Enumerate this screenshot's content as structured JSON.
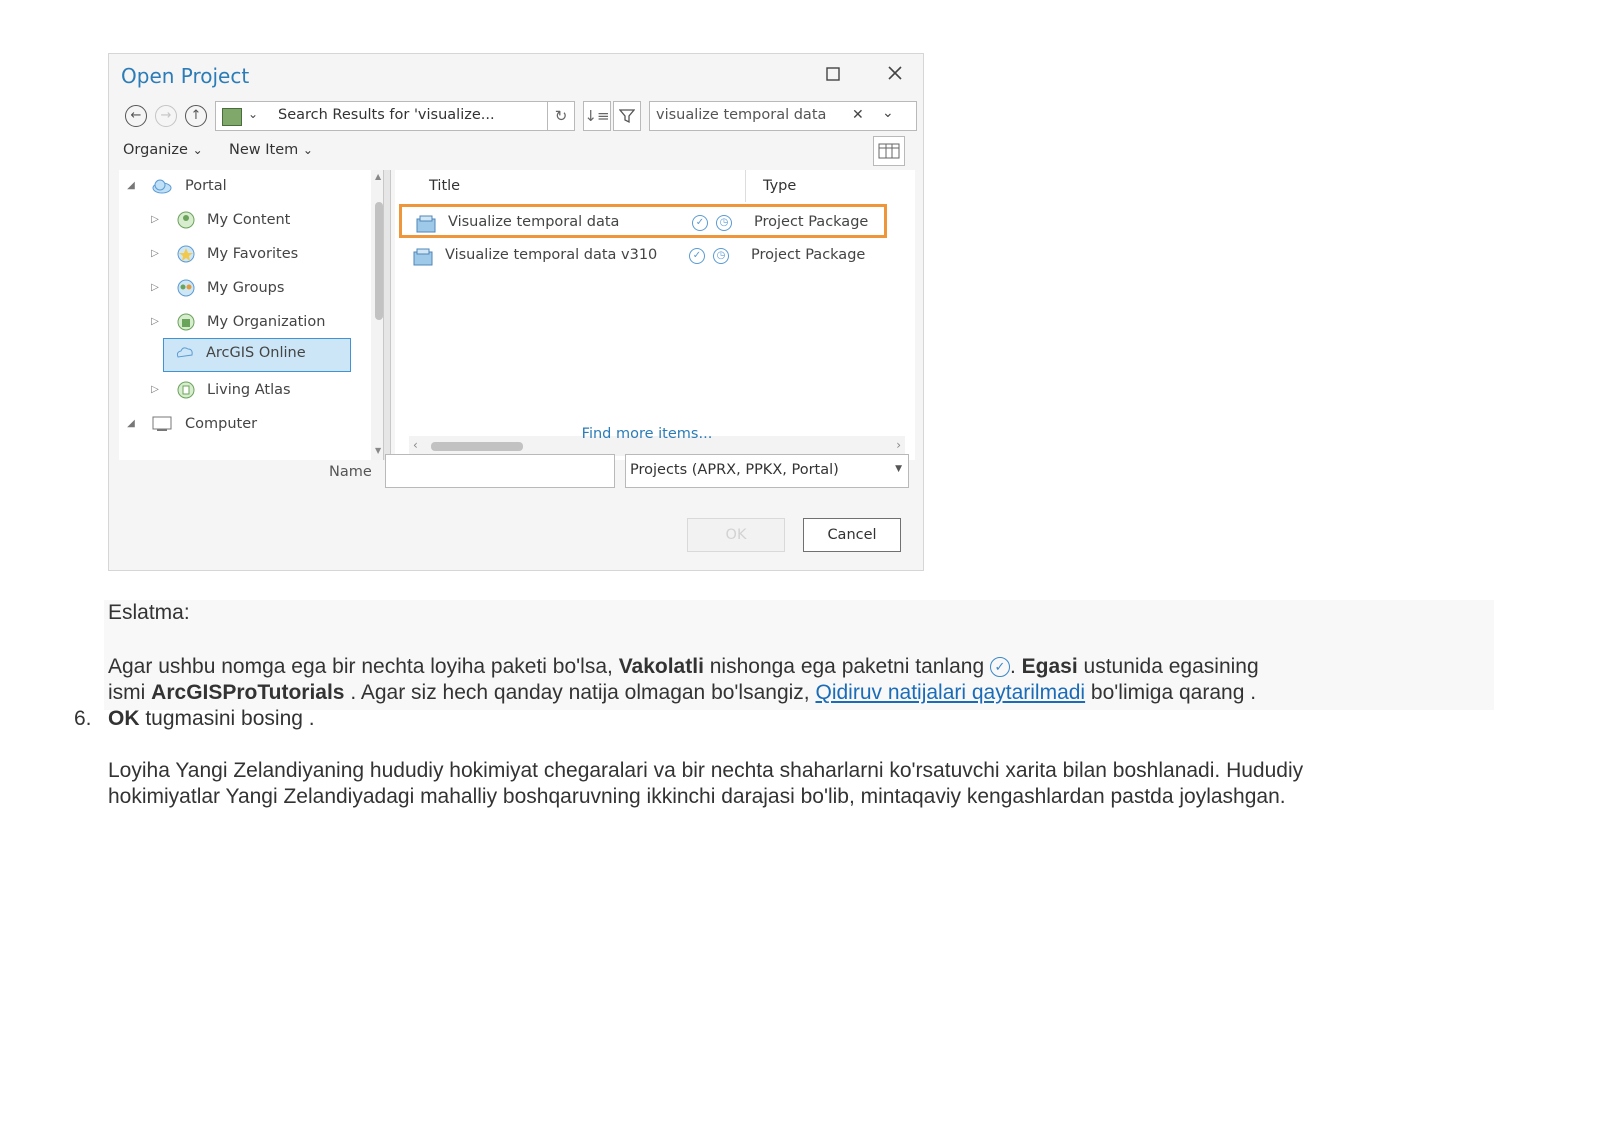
{
  "dialog": {
    "title": "Open Project",
    "path_text": "Search Results for 'visualize...",
    "search_value": "visualize temporal data",
    "menu": {
      "organize": "Organize",
      "new_item": "New Item"
    },
    "tree": [
      {
        "label": "Portal",
        "expanded": true
      },
      {
        "label": "My Content"
      },
      {
        "label": "My Favorites"
      },
      {
        "label": "My Groups"
      },
      {
        "label": "My Organization"
      },
      {
        "label": "ArcGIS Online",
        "selected": true
      },
      {
        "label": "Living Atlas"
      },
      {
        "label": "Computer",
        "expanded": true
      }
    ],
    "columns": {
      "title": "Title",
      "type": "Type"
    },
    "rows": [
      {
        "title": "Visualize temporal data",
        "type": "Project Package",
        "highlighted": true
      },
      {
        "title": "Visualize temporal data v310",
        "type": "Project Package"
      }
    ],
    "find_more": "Find more items...",
    "name_label": "Name",
    "name_value": "",
    "file_type": "Projects (APRX, PPKX, Portal)",
    "ok_label": "OK",
    "cancel_label": "Cancel"
  },
  "doc": {
    "note_heading": "Eslatma:",
    "note_p1_a": "Agar ushbu nomga ega bir nechta loyiha paketi bo'lsa, ",
    "note_p1_b": "Vakolatli",
    "note_p1_c": " nishonga ega paketni tanlang ",
    "note_p1_d": ". ",
    "note_p1_e": "Egasi",
    "note_p1_f": " ustunida egasining",
    "note_p2_a": "ismi ",
    "note_p2_b": "ArcGISProTutorials",
    "note_p2_c": " . Agar siz hech qanday natija olmagan bo'lsangiz, ",
    "note_p2_link": "Qidiruv natijalari qaytarilmadi",
    "note_p2_d": " bo'limiga qarang .",
    "step_number": "6.",
    "step_bold": "OK",
    "step_text": " tugmasini bosing .",
    "para_line1": "Loyiha Yangi Zelandiyaning hududiy hokimiyat chegaralari va bir nechta shaharlarni ko'rsatuvchi xarita bilan boshlanadi. Hududiy",
    "para_line2": "hokimiyatlar Yangi Zelandiyadagi mahalliy boshqaruvning ikkinchi darajasi bo'lib, mintaqaviy kengashlardan pastda joylashgan."
  }
}
